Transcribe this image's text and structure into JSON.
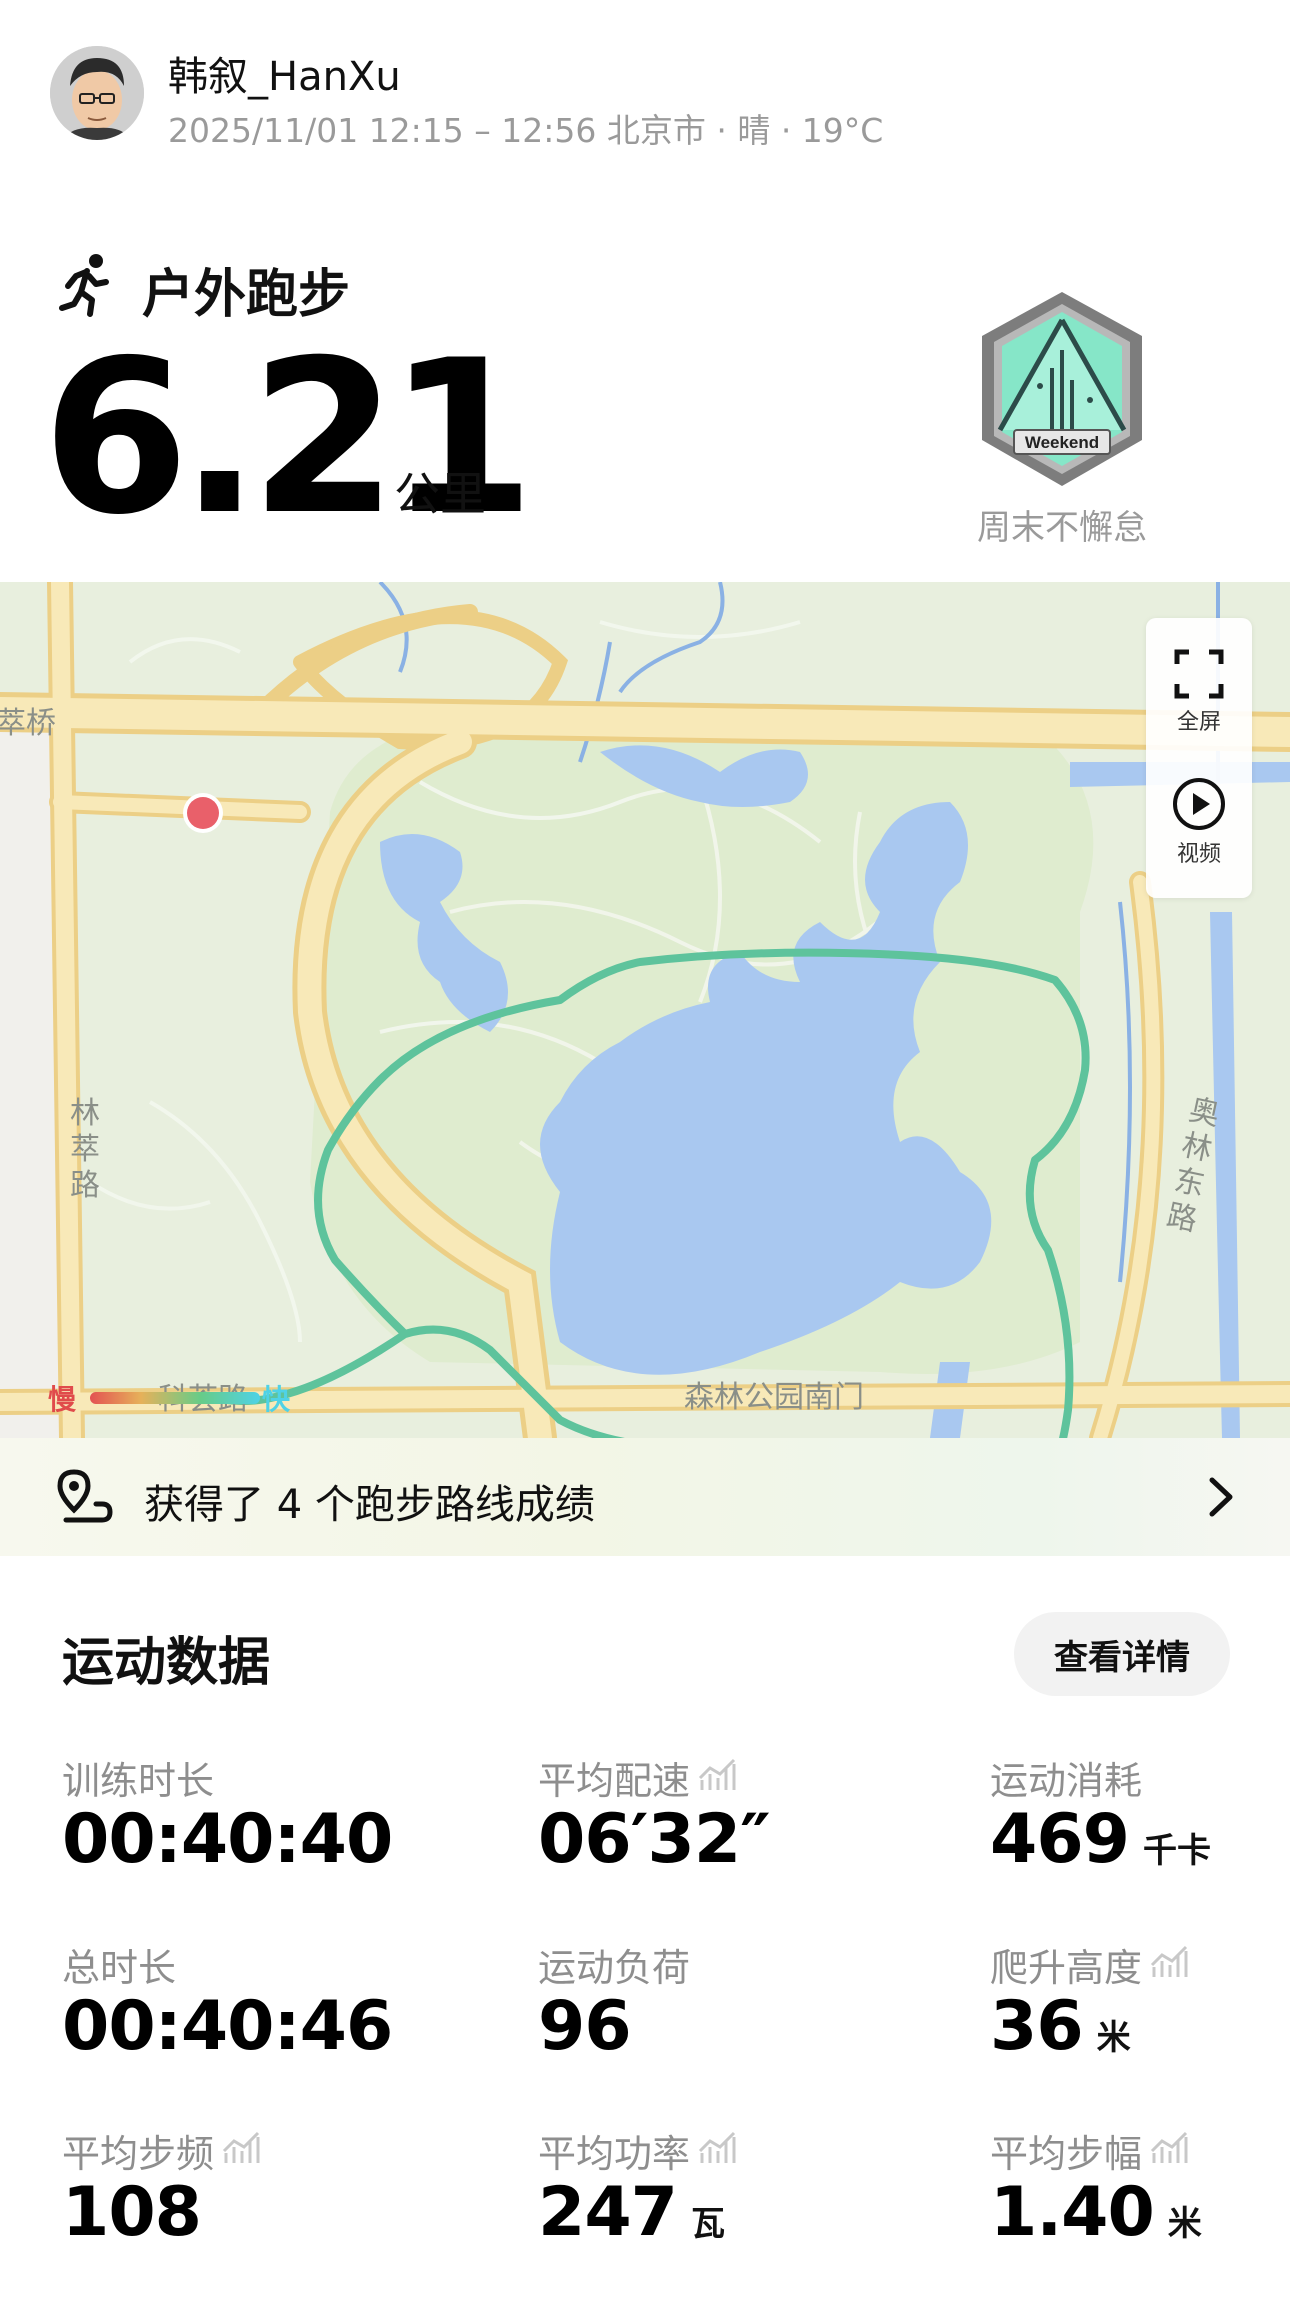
{
  "header": {
    "username": "韩叙_HanXu",
    "subline": "2025/11/01 12:15 – 12:56 北京市 · 晴 · 19°C"
  },
  "activity": {
    "title": "户外跑步",
    "distance": "6.21",
    "unit": "公里"
  },
  "badge": {
    "text": "Weekend",
    "label": "周末不懈怠"
  },
  "map": {
    "labels": {
      "cuiqiao": "萃桥",
      "lincui_road": "林萃路",
      "kehui_road": "科荟路",
      "aolin_east_road": "奥林东路",
      "south_gate": "森林公园南门"
    },
    "tools": {
      "fullscreen": "全屏",
      "video": "视频"
    },
    "legend": {
      "slow": "慢",
      "fast": "快"
    },
    "colors": {
      "route": "#5ac39a",
      "water": "#a9c8f0",
      "road": "#f7e3a4",
      "park": "#e4efd8"
    }
  },
  "achievement": {
    "text": "获得了 4 个跑步路线成绩"
  },
  "stats_section": {
    "title": "运动数据",
    "detail_button": "查看详情",
    "items": [
      {
        "label": "训练时长",
        "value": "00:40:40",
        "unit": "",
        "trend": false
      },
      {
        "label": "平均配速",
        "value": "06′32″",
        "unit": "",
        "trend": true
      },
      {
        "label": "运动消耗",
        "value": "469",
        "unit": "千卡",
        "trend": false
      },
      {
        "label": "总时长",
        "value": "00:40:46",
        "unit": "",
        "trend": false
      },
      {
        "label": "运动负荷",
        "value": "96",
        "unit": "",
        "trend": false
      },
      {
        "label": "爬升高度",
        "value": "36",
        "unit": "米",
        "trend": true
      },
      {
        "label": "平均步频",
        "value": "108",
        "unit": "",
        "trend": true
      },
      {
        "label": "平均功率",
        "value": "247",
        "unit": "瓦",
        "trend": true
      },
      {
        "label": "平均步幅",
        "value": "1.40",
        "unit": "米",
        "trend": true
      }
    ]
  }
}
